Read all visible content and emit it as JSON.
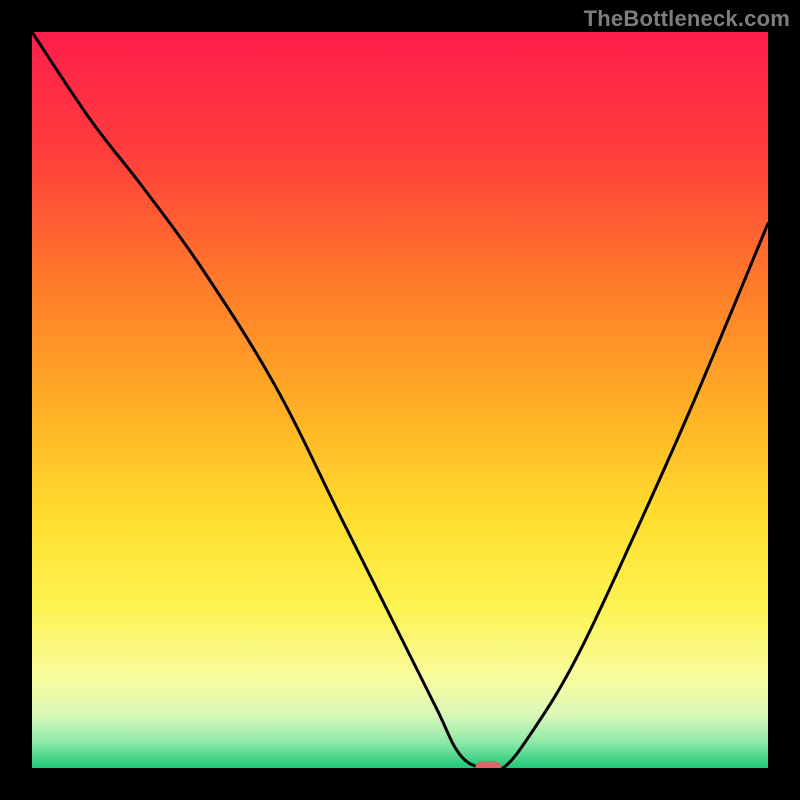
{
  "watermark": "TheBottleneck.com",
  "chart_data": {
    "type": "line",
    "title": "",
    "xlabel": "",
    "ylabel": "",
    "xlim": [
      0,
      100
    ],
    "ylim": [
      0,
      100
    ],
    "series": [
      {
        "name": "bottleneck-curve",
        "x": [
          0,
          8,
          15,
          23,
          33,
          42,
          50,
          55,
          58,
          61,
          64,
          68,
          74,
          82,
          90,
          100
        ],
        "y": [
          100,
          88,
          79,
          68,
          52,
          34,
          18,
          8,
          2,
          0,
          0,
          5,
          15,
          32,
          50,
          74
        ]
      }
    ],
    "optimal_marker": {
      "x": 62,
      "y": 0
    },
    "gradient_stops": [
      {
        "offset": 0.0,
        "color": "#ff1e4b"
      },
      {
        "offset": 0.16,
        "color": "#ff3c3c"
      },
      {
        "offset": 0.34,
        "color": "#ff7a2a"
      },
      {
        "offset": 0.52,
        "color": "#ffb225"
      },
      {
        "offset": 0.66,
        "color": "#ffde2f"
      },
      {
        "offset": 0.78,
        "color": "#fdf350"
      },
      {
        "offset": 0.88,
        "color": "#f8fca0"
      },
      {
        "offset": 0.93,
        "color": "#d7f7b8"
      },
      {
        "offset": 0.965,
        "color": "#8de9a8"
      },
      {
        "offset": 1.0,
        "color": "#1fc877"
      }
    ],
    "marker_color": "#d46a6a",
    "curve_color": "#000000"
  }
}
